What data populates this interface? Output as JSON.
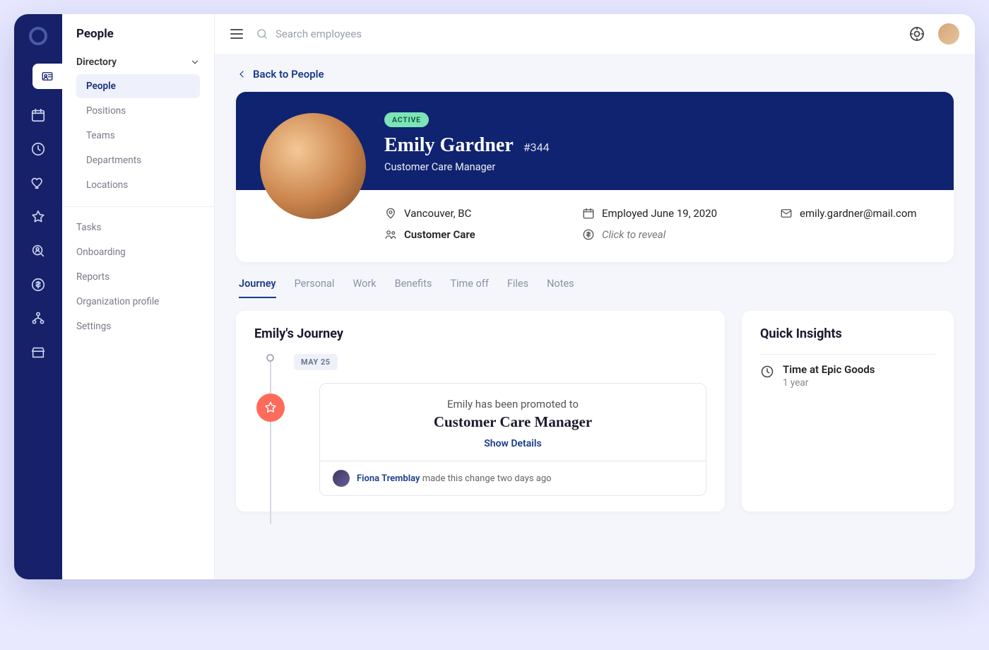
{
  "sidebar": {
    "title": "People",
    "section_label": "Directory",
    "directory_items": [
      "People",
      "Positions",
      "Teams",
      "Departments",
      "Locations"
    ],
    "other_items": [
      "Tasks",
      "Onboarding",
      "Reports",
      "Organization profile",
      "Settings"
    ]
  },
  "topbar": {
    "search_placeholder": "Search employees"
  },
  "back_label": "Back to People",
  "profile": {
    "status": "ACTIVE",
    "name": "Emily Gardner",
    "id": "#344",
    "role": "Customer Care Manager",
    "location": "Vancouver, BC",
    "department": "Customer Care",
    "employed": "Employed June 19, 2020",
    "salary": "Click to reveal",
    "email": "emily.gardner@mail.com"
  },
  "tabs": [
    "Journey",
    "Personal",
    "Work",
    "Benefits",
    "Time off",
    "Files",
    "Notes"
  ],
  "journey": {
    "title": "Emily's Journey",
    "date": "MAY 25",
    "line1": "Emily has been promoted to",
    "line2": "Customer Care Manager",
    "details_link": "Show Details",
    "changed_by": "Fiona Tremblay",
    "changed_suffix": " made this change two days ago"
  },
  "insights": {
    "title": "Quick Insights",
    "item_label": "Time at Epic Goods",
    "item_value": "1 year"
  }
}
